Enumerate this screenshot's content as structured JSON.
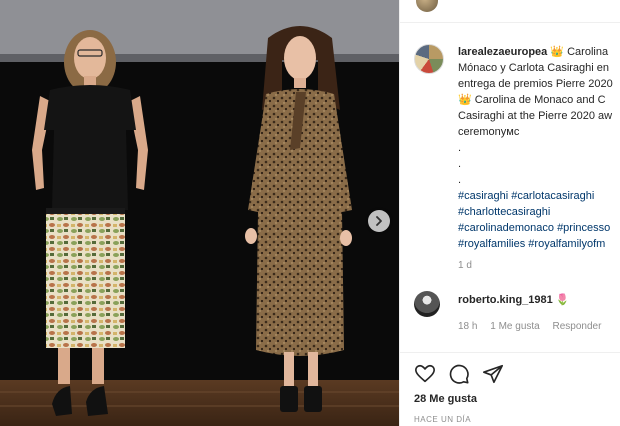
{
  "post": {
    "caption": {
      "username": "larealezaeuropea",
      "crown1": "👑",
      "line1": " Carolina",
      "line2": "Mónaco y Carlota Casiraghi en",
      "line3": "entrega de premios Pierre 2020",
      "crown2": "👑",
      "line4": " Carolina de Monaco and C",
      "line5": "Casiraghi at the Pierre 2020 aw",
      "line6": "ceremonyмс",
      "dots": [
        ".",
        ".",
        "."
      ],
      "hashtags": [
        "#casiraghi #carlotacasiraghi",
        "#charlottecasiraghi",
        "#carolinademonaco #princesso",
        "#royalfamilies #royalfamilyofm"
      ],
      "time": "1 d"
    },
    "comment": {
      "username": "roberto.king_1981",
      "emoji": "🌷",
      "time": "18 h",
      "likes": "1 Me gusta",
      "reply": "Responder"
    },
    "likes_count": "28 Me gusta",
    "posted_ago": "HACE UN DÍA"
  },
  "icons": {
    "next": "chevron-right-icon",
    "like": "heart-icon",
    "comment": "comment-icon",
    "share": "paper-plane-icon"
  },
  "colors": {
    "hashtag": "#00376b",
    "muted": "#8e8e8e",
    "text": "#262626"
  }
}
